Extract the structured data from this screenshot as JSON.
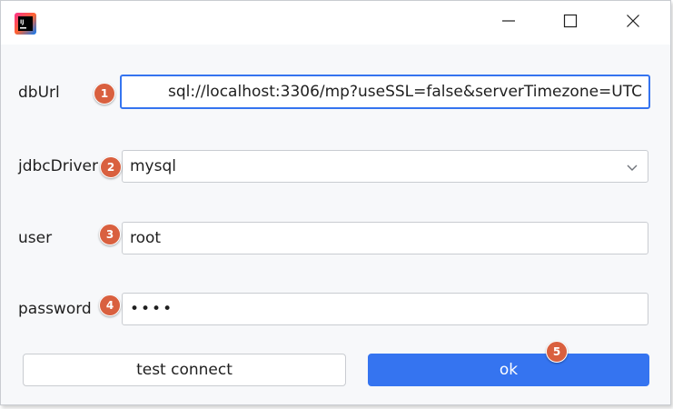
{
  "window": {
    "controls": {
      "minimize_icon": "minimize-icon",
      "maximize_icon": "maximize-icon",
      "close_icon": "close-icon"
    },
    "app_icon": "intellij-idea-icon"
  },
  "form": {
    "dbUrl": {
      "label": "dbUrl",
      "value": "sql://localhost:3306/mp?useSSL=false&serverTimezone=UTC",
      "badge": "1"
    },
    "jdbcDriver": {
      "label": "jdbcDriver",
      "value": "mysql",
      "badge": "2"
    },
    "user": {
      "label": "user",
      "value": "root",
      "badge": "3"
    },
    "password": {
      "label": "password",
      "value": "••••",
      "badge": "4"
    }
  },
  "buttons": {
    "test_connect": "test connect",
    "ok": "ok",
    "ok_badge": "5"
  },
  "colors": {
    "accent": "#3574f0",
    "badge": "#d9603f",
    "background": "#f7f8fa"
  }
}
